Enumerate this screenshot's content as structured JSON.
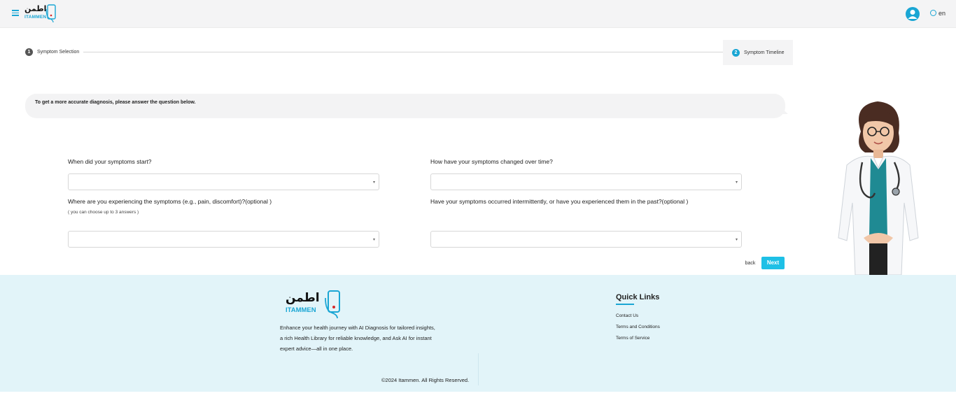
{
  "header": {
    "logo_arabic": "اطمن",
    "logo_text": "ITAMMEN",
    "menu_icon": "hamburger-menu-icon",
    "avatar_icon": "user-avatar-icon",
    "language": "en",
    "language_icon": "globe-icon"
  },
  "stepper": {
    "steps": [
      {
        "number": "1",
        "label": "Symptom Selection"
      },
      {
        "number": "2",
        "label": "Symptom Timeline"
      }
    ]
  },
  "prompt": {
    "text": "To get a more accurate diagnosis, please answer the question below."
  },
  "form": {
    "q1": {
      "label": "When did your symptoms start?",
      "value": ""
    },
    "q2": {
      "label": "How have your symptoms changed over time?",
      "value": ""
    },
    "q3": {
      "label": "Where are you experiencing the symptoms (e.g., pain, discomfort)?(optional )",
      "hint": "( you can choose up to 3 answers )",
      "value": ""
    },
    "q4": {
      "label": "Have your symptoms occurred intermittently, or have you experienced them in the past?(optional )",
      "value": ""
    }
  },
  "actions": {
    "back_label": "back",
    "next_label": "Next"
  },
  "footer": {
    "logo_arabic": "اطمن",
    "logo_text": "ITAMMEN",
    "description_lines": [
      "Enhance your health journey with AI Diagnosis for tailored insights,",
      "a rich Health Library for reliable knowledge, and Ask AI for instant",
      "expert advice—all in one place."
    ],
    "copyright": "©2024 Itammen. All Rights Reserved.",
    "quick_links_title": "Quick Links",
    "links": [
      "Contact Us",
      "Terms and Conditions",
      "Terms of Service"
    ]
  },
  "colors": {
    "accent": "#1aa6d4",
    "next_button": "#1ec0e6",
    "footer_bg": "#e2f4f9"
  }
}
